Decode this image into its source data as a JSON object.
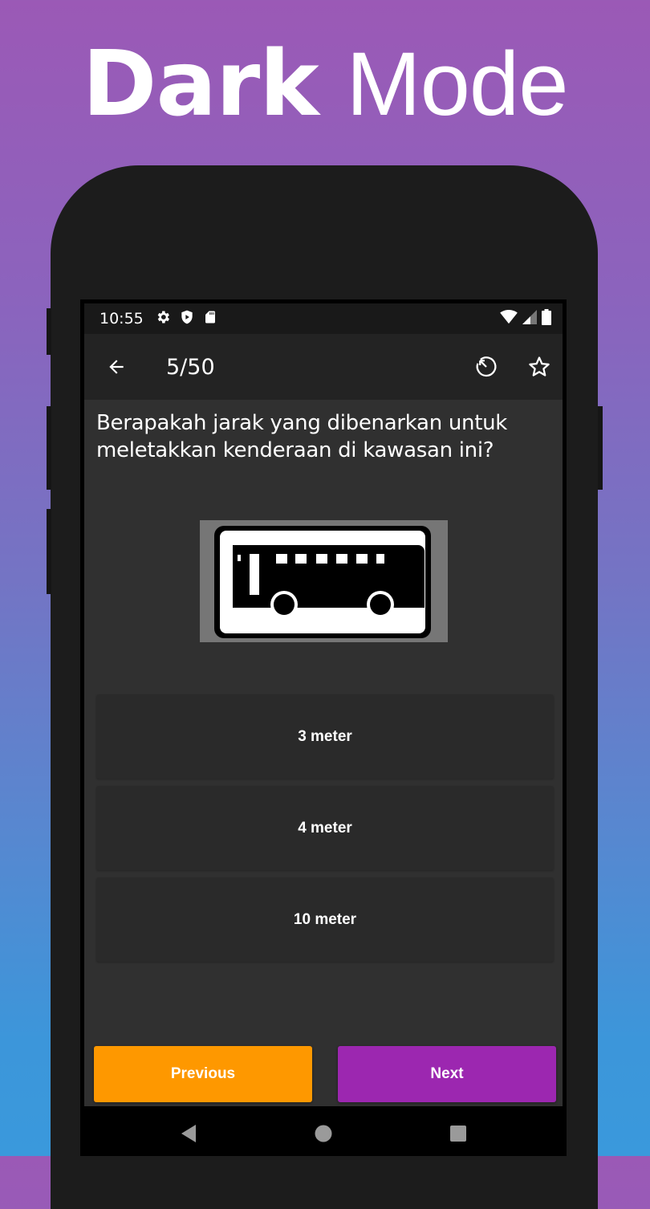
{
  "headline": {
    "bold": "Dark",
    "light": "Mode"
  },
  "status_bar": {
    "time": "10:55",
    "left_icons": [
      "settings-icon",
      "shield-play-icon",
      "sd-card-icon"
    ],
    "right_icons": [
      "wifi-icon",
      "signal-icon",
      "battery-icon"
    ]
  },
  "app_bar": {
    "back_icon": "arrow-left-icon",
    "title": "5/50",
    "actions": [
      "restart-timer-icon",
      "star-outline-icon"
    ]
  },
  "question": {
    "text": "Berapakah jarak yang dibenarkan untuk meletakkan kenderaan di kawasan ini?",
    "image": "bus-parking-sign"
  },
  "options": [
    {
      "label": "3 meter"
    },
    {
      "label": "4 meter"
    },
    {
      "label": "10 meter"
    }
  ],
  "buttons": {
    "previous": "Previous",
    "next": "Next"
  },
  "colors": {
    "previous_button": "#fe9800",
    "next_button": "#9c27b0",
    "content_bg": "#303030",
    "option_bg": "#2a2a2a"
  },
  "system_nav": [
    "back-triangle-icon",
    "home-circle-icon",
    "recents-square-icon"
  ]
}
